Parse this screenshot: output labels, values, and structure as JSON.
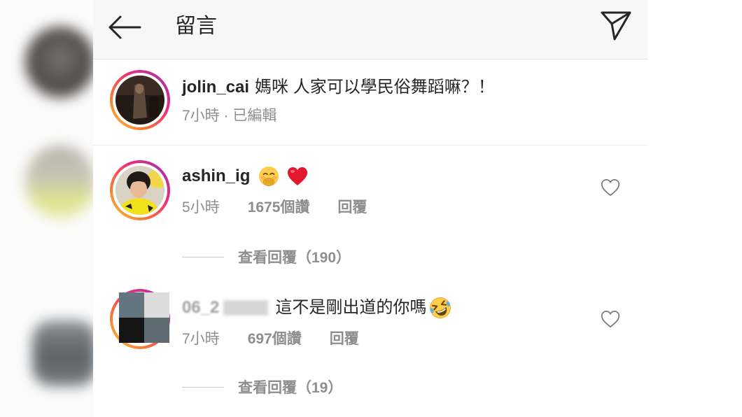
{
  "header": {
    "title": "留言",
    "back_icon": "arrow-left-icon",
    "share_icon": "paper-plane-icon"
  },
  "caption": {
    "username": "jolin_cai",
    "text": "媽咪 人家可以學民俗舞蹈嘛？！",
    "meta": "7小時 · 已編輯"
  },
  "comments": [
    {
      "username": "ashin_ig",
      "emojis": [
        "face-with-hand-over-mouth-emoji",
        "red-heart-emoji"
      ],
      "time": "5小時",
      "likes": "1675個讚",
      "reply_label": "回覆",
      "view_replies": "查看回覆（190）",
      "like_icon": "heart-outline-icon"
    },
    {
      "username": "06_2",
      "text": "這不是剛出道的你嗎",
      "emojis": [
        "rolling-on-the-floor-laughing-emoji"
      ],
      "time": "7小時",
      "likes": "697個讚",
      "reply_label": "回覆",
      "view_replies": "查看回覆（19）",
      "like_icon": "heart-outline-icon"
    }
  ],
  "colors": {
    "text": "#262626",
    "meta": "#8e8e8e",
    "ring1": "#f9ce34",
    "ring2": "#f77737",
    "ring3": "#ee2a7b",
    "ring4": "#8a3ab9",
    "heart_red": "#e3172d",
    "like_icon": "#7a7a7a"
  }
}
